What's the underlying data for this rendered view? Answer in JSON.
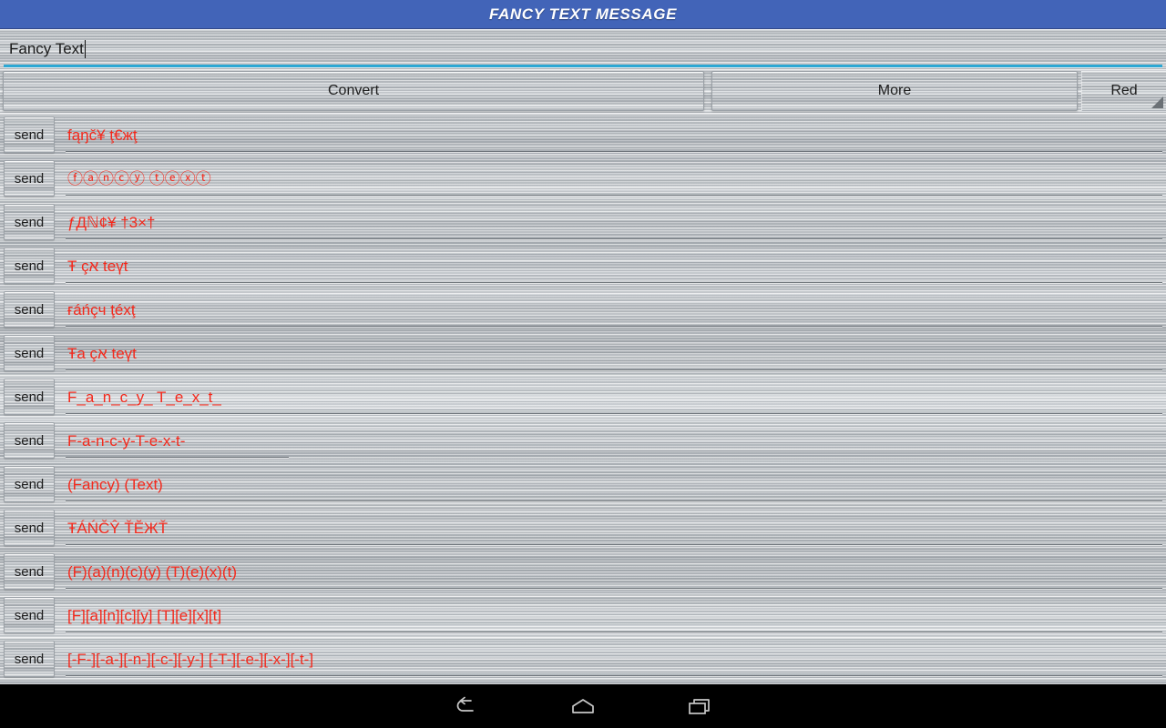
{
  "window": {
    "title": "FANCY TEXT MESSAGE",
    "title_bar_color": "#4264b8",
    "accent_underline_color": "#2ca8d4",
    "fancy_text_color": "#f4291c"
  },
  "input": {
    "name": "fancy-text-input",
    "value": "Fancy Text",
    "placeholder": "Fancy Text"
  },
  "buttons": {
    "convert_label": "Convert",
    "more_label": "More"
  },
  "color_spinner": {
    "selected": "Red",
    "options": [
      "Red"
    ]
  },
  "list": {
    "send_label": "send",
    "rows": [
      {
        "send": "send",
        "fancy": "fąŋč¥ ţ€жţ",
        "rule": "full"
      },
      {
        "send": "send",
        "fancy": "ⓕⓐⓝⓒⓨ ⓣⓔⓧⓣ",
        "rule": "full"
      },
      {
        "send": "send",
        "fancy": "ƒДℕ¢¥ †3×†",
        "rule": "full"
      },
      {
        "send": "send",
        "fancy": "Ŧ çא teүt",
        "rule": "full"
      },
      {
        "send": "send",
        "fancy": "ғáńçч ţéxţ",
        "rule": "full"
      },
      {
        "send": "send",
        "fancy": "Ŧa çא teүt",
        "rule": "full"
      },
      {
        "send": "send",
        "fancy": "F_a_n_c_y_ T_e_x_t_",
        "rule": "full"
      },
      {
        "send": "send",
        "fancy": "F-a-n-c-y-T-e-x-t-",
        "rule": "short"
      },
      {
        "send": "send",
        "fancy": "(Fancy) (Text)",
        "rule": "full"
      },
      {
        "send": "send",
        "fancy": "ŦÁŃČŶ ŤĔЖŤ",
        "rule": "full"
      },
      {
        "send": "send",
        "fancy": "(F)(a)(n)(c)(y) (T)(e)(x)(t)",
        "rule": "full"
      },
      {
        "send": "send",
        "fancy": "[F][a][n][c][y] [T][e][x][t]",
        "rule": "full"
      },
      {
        "send": "send",
        "fancy": "[-F-][-a-][-n-][-c-][-y-] [-T-][-e-][-x-][-t-]",
        "rule": "full"
      }
    ]
  },
  "navbar": {
    "back": "back-icon",
    "home": "home-icon",
    "recents": "recents-icon"
  }
}
